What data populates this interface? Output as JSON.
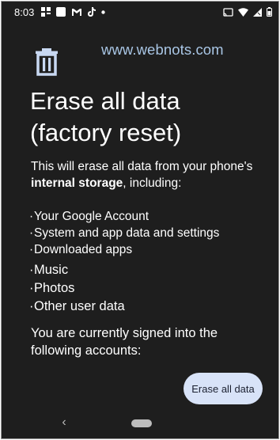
{
  "status_bar": {
    "time": "8:03"
  },
  "watermark": "www.webnots.com",
  "title": "Erase all data (factory reset)",
  "description": {
    "before": "This will erase all data from your phone's ",
    "bold": "internal storage",
    "after": ", including:"
  },
  "items_small": [
    "Your Google Account",
    "System and app data and settings",
    "Downloaded apps"
  ],
  "items_large": [
    "Music",
    "Photos",
    "Other user data"
  ],
  "bullet": "·",
  "signed_in_text": "You are currently signed into the following accounts:",
  "erase_button": "Erase all data",
  "nav": {
    "back_glyph": "‹"
  },
  "colors": {
    "background": "#1e1e1e",
    "button_bg": "#d8e3f8",
    "watermark": "#a9c6e5"
  }
}
